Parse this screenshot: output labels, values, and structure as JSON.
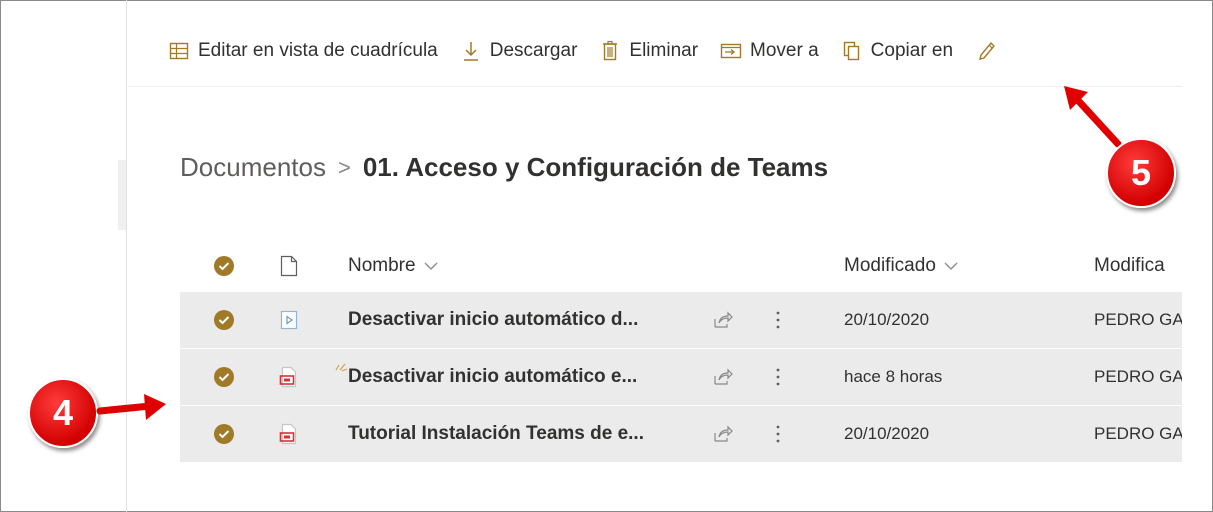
{
  "toolbar": {
    "items": [
      {
        "label": "Editar en vista de cuadrícula",
        "icon": "grid-icon"
      },
      {
        "label": "Descargar",
        "icon": "download-icon"
      },
      {
        "label": "Eliminar",
        "icon": "trash-icon"
      },
      {
        "label": "Mover a",
        "icon": "move-icon"
      },
      {
        "label": "Copiar en",
        "icon": "copy-icon"
      },
      {
        "label": "",
        "icon": "pencil-icon"
      }
    ]
  },
  "breadcrumb": {
    "root": "Documentos",
    "separator": ">",
    "current": "01. Acceso y Configuración de Teams"
  },
  "list": {
    "columns": {
      "name": "Nombre",
      "modified": "Modificado",
      "modified_by": "Modifica"
    },
    "rows": [
      {
        "name": "Desactivar inicio automático d...",
        "modified": "20/10/2020",
        "modified_by": "PEDRO GA",
        "type": "video-file-icon",
        "selected": true
      },
      {
        "name": "Desactivar inicio automático e...",
        "modified": "hace 8 horas",
        "modified_by": "PEDRO GA",
        "type": "pdf-file-icon",
        "selected": true,
        "new": true
      },
      {
        "name": "Tutorial Instalación Teams de e...",
        "modified": "20/10/2020",
        "modified_by": "PEDRO GA",
        "type": "pdf-file-icon",
        "selected": true
      }
    ]
  },
  "annotations": {
    "badge4": "4",
    "badge5": "5"
  },
  "colors": {
    "accent": "#a07a27",
    "badge": "#e00000",
    "row_selected": "#ebebeb"
  }
}
